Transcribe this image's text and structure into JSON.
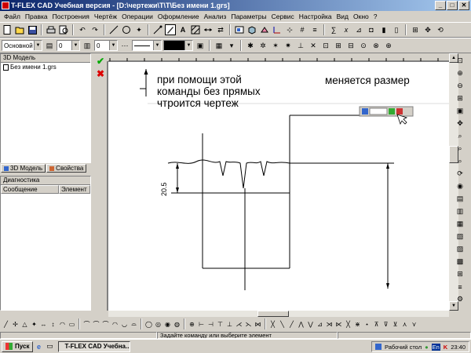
{
  "window": {
    "title": "T-FLEX CAD Учебная версия - [D:\\чертежи\\Т\\Т\\Без имени 1.grs]",
    "btn_minimize": "_",
    "btn_restore": "□",
    "btn_close": "✕"
  },
  "menu": [
    "Файл",
    "Правка",
    "Построения",
    "Чертёж",
    "Операции",
    "Оформление",
    "Анализ",
    "Параметры",
    "Сервис",
    "Настройка",
    "Вид",
    "Окно",
    "?"
  ],
  "toolbar2": {
    "style_combo": "Основной",
    "field_a": "0",
    "field_b": "0"
  },
  "left_panel": {
    "model_header": "3D Модель",
    "tree_item": "Без имени 1.grs",
    "tab_model": "3D Модель",
    "tab_props": "Свойства",
    "diag_header": "Диагностика",
    "col_message": "Сообщение",
    "col_element": "Элемент"
  },
  "annotations": {
    "left_text": "при помощи этой\nкоманды без прямых\nчтроится чертеж",
    "right_text": "меняется размер"
  },
  "drawing": {
    "dim_value": "20.5"
  },
  "statusbar": {
    "hint": "Задайте команду или выберите элемент"
  },
  "taskbar": {
    "start": "Пуск",
    "task": "T-FLEX CAD Учебна...",
    "desktop": "Рабочий стол",
    "lang": "En",
    "clock": "23:40"
  }
}
